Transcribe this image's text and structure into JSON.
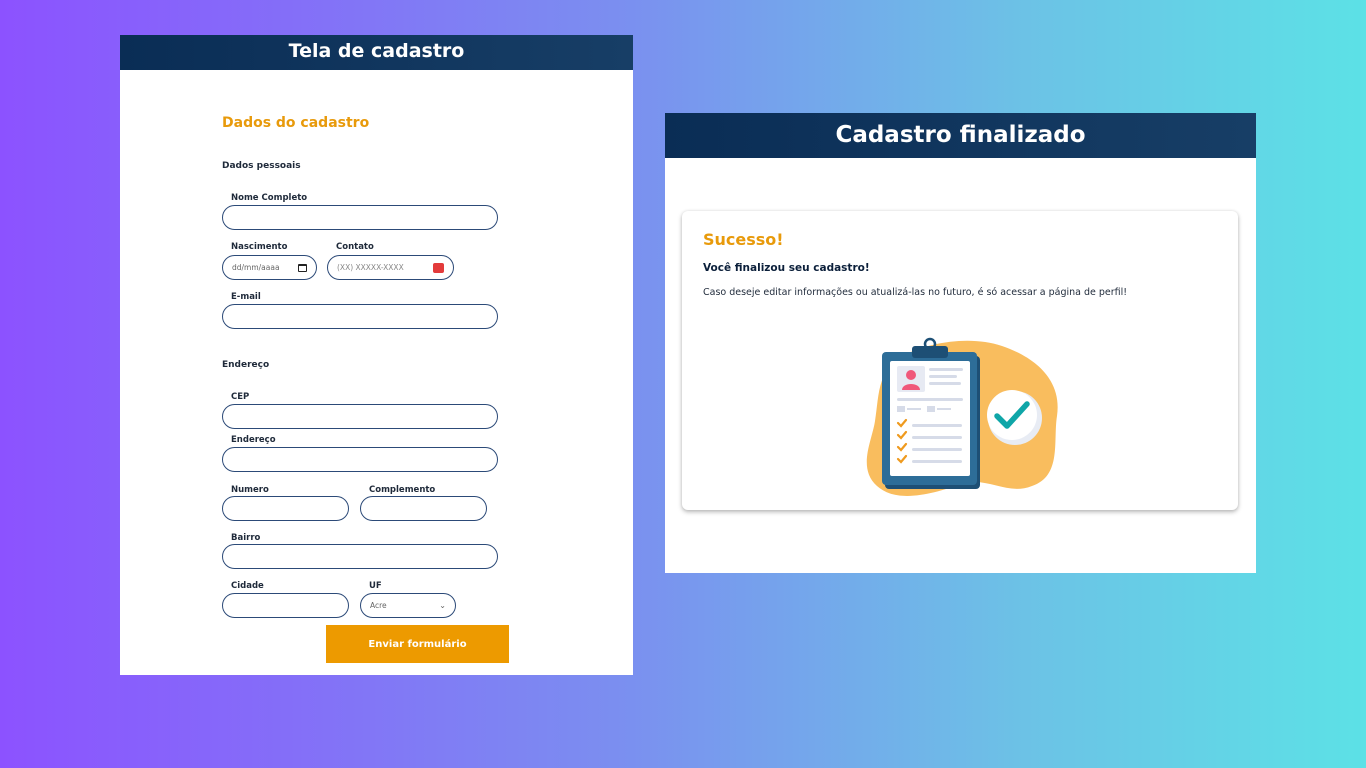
{
  "form_screen": {
    "title": "Tela de cadastro",
    "section_title": "Dados do cadastro",
    "personal_group": "Dados pessoais",
    "fields": {
      "full_name": {
        "label": "Nome Completo",
        "value": ""
      },
      "birth": {
        "label": "Nascimento",
        "placeholder": "dd/mm/aaaa"
      },
      "contact": {
        "label": "Contato",
        "placeholder": "(XX) XXXXX-XXXX"
      },
      "email": {
        "label": "E-mail",
        "value": ""
      },
      "cep": {
        "label": "CEP",
        "value": ""
      },
      "address": {
        "label": "Endereço",
        "value": ""
      },
      "number": {
        "label": "Numero",
        "value": ""
      },
      "complement": {
        "label": "Complemento",
        "value": ""
      },
      "district": {
        "label": "Bairro",
        "value": ""
      },
      "city": {
        "label": "Cidade",
        "value": ""
      },
      "state": {
        "label": "UF",
        "selected": "Acre"
      }
    },
    "address_group": "Endereço",
    "submit_label": "Enviar formulário"
  },
  "success_screen": {
    "title": "Cadastro finalizado",
    "heading": "Sucesso!",
    "subheading": "Você finalizou seu cadastro!",
    "message": "Caso deseje editar informações ou atualizá-las no futuro, é só acessar a página de perfil!",
    "illustration_icon": "clipboard-check-icon"
  },
  "colors": {
    "header": "#0a2d55",
    "accent": "#e89a0b",
    "button": "#ed9a00",
    "success_check": "#0fa6a8"
  }
}
